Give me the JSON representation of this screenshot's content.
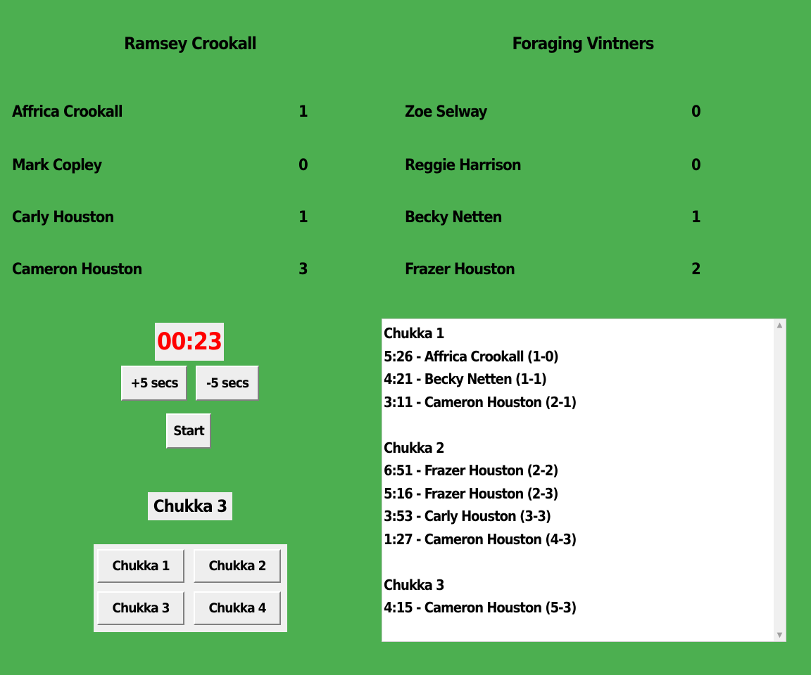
{
  "teams": {
    "a": {
      "name": "Ramsey Crookall",
      "players": [
        {
          "name": "Affrica Crookall",
          "score": "1"
        },
        {
          "name": "Mark Copley",
          "score": "0"
        },
        {
          "name": "Carly Houston",
          "score": "1"
        },
        {
          "name": "Cameron Houston",
          "score": "3"
        }
      ]
    },
    "b": {
      "name": "Foraging Vintners",
      "players": [
        {
          "name": "Zoe Selway",
          "score": "0"
        },
        {
          "name": "Reggie Harrison",
          "score": "0"
        },
        {
          "name": "Becky Netten",
          "score": "1"
        },
        {
          "name": "Frazer Houston",
          "score": "2"
        }
      ]
    }
  },
  "timer": {
    "display": "00:23",
    "plus_label": "+5 secs",
    "minus_label": "-5 secs",
    "start_label": "Start"
  },
  "current_chukka": "Chukka 3",
  "chukka_buttons": [
    "Chukka 1",
    "Chukka 2",
    "Chukka 3",
    "Chukka 4"
  ],
  "log": [
    "Chukka 1",
    "5:26 - Affrica Crookall (1-0)",
    "4:21 - Becky Netten (1-1)",
    "3:11 - Cameron Houston (2-1)",
    "",
    "Chukka 2",
    "6:51 - Frazer Houston (2-2)",
    "5:16 - Frazer Houston (2-3)",
    "3:53 - Carly Houston (3-3)",
    "1:27 - Cameron Houston (4-3)",
    "",
    "Chukka 3",
    "4:15 - Cameron Houston (5-3)"
  ],
  "icons": {
    "scroll_up": "scroll-up-arrow",
    "scroll_down": "scroll-down-arrow"
  },
  "colors": {
    "background": "#4caf50",
    "timer_text": "#ff0000",
    "panel": "#eeeeee"
  }
}
